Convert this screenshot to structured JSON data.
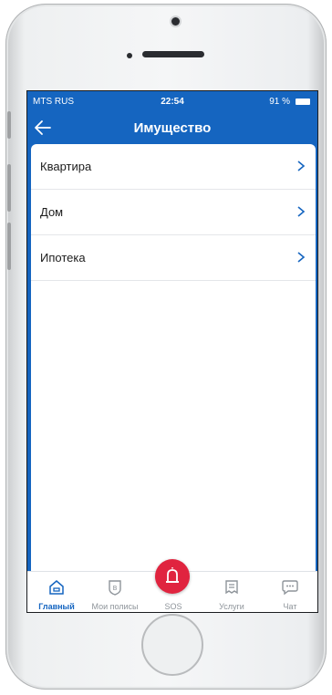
{
  "status_bar": {
    "carrier": "MTS RUS",
    "time": "22:54",
    "battery": "91 %"
  },
  "app_bar": {
    "title": "Имущество"
  },
  "list": {
    "items": [
      {
        "label": "Квартира"
      },
      {
        "label": "Дом"
      },
      {
        "label": "Ипотека"
      }
    ]
  },
  "tab_bar": {
    "tabs": [
      {
        "label": "Главный",
        "icon": "home-icon",
        "active": true
      },
      {
        "label": "Мои полисы",
        "icon": "policy-shield-icon",
        "active": false
      },
      {
        "label": "SOS",
        "icon": "alarm-siren-icon",
        "active": false
      },
      {
        "label": "Услуги",
        "icon": "services-list-icon",
        "active": false
      },
      {
        "label": "Чат",
        "icon": "chat-bubble-icon",
        "active": false
      }
    ]
  },
  "colors": {
    "primary": "#1565c0",
    "sos": "#e0243f",
    "inactive": "#8e949a"
  }
}
